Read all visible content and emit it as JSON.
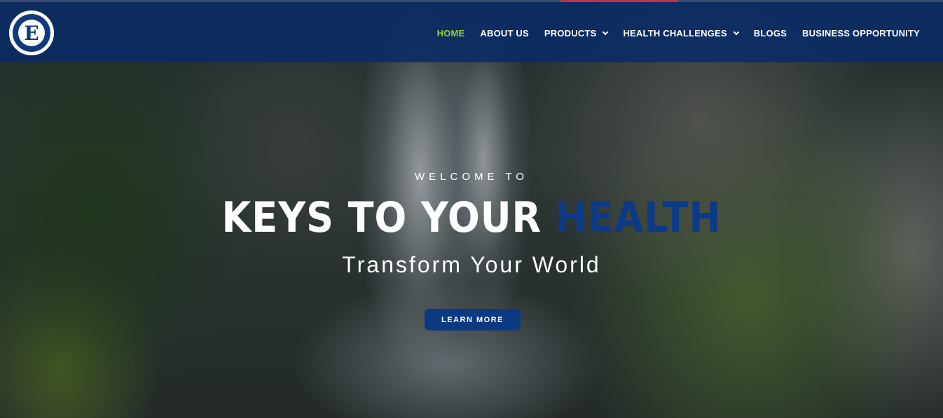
{
  "header": {
    "logo_alt": "Enagic Independent Distributor",
    "nav": [
      {
        "label": "HOME",
        "active": true,
        "has_dropdown": false
      },
      {
        "label": "ABOUT US",
        "active": false,
        "has_dropdown": false
      },
      {
        "label": "PRODUCTS",
        "active": false,
        "has_dropdown": true
      },
      {
        "label": "HEALTH CHALLENGES",
        "active": false,
        "has_dropdown": true
      },
      {
        "label": "BLOGS",
        "active": false,
        "has_dropdown": false
      },
      {
        "label": "BUSINESS OPPORTUNITY",
        "active": false,
        "has_dropdown": false
      }
    ]
  },
  "hero": {
    "welcome": "WELCOME TO",
    "headline_white": "KEYS TO YOUR ",
    "headline_blue": "HEALTH",
    "tagline": "Transform Your World",
    "cta_label": "LEARN MORE",
    "background_icon": "waterfall-photo"
  },
  "colors": {
    "header_bg": "#092b66",
    "nav_active": "#9bcb3c",
    "headline_accent": "#0d3a86",
    "button_bg": "#0b3a82"
  }
}
